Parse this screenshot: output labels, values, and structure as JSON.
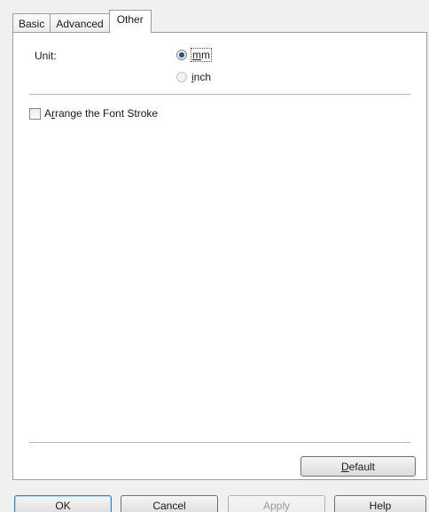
{
  "tabs": [
    {
      "label": "Basic",
      "active": false
    },
    {
      "label": "Advanced",
      "active": false
    },
    {
      "label": "Other",
      "active": true
    }
  ],
  "unit": {
    "label": "Unit:",
    "options": [
      {
        "label_first": "m",
        "label_rest": "m",
        "selected": true
      },
      {
        "label_first": "i",
        "label_rest": "nch",
        "selected": false
      }
    ]
  },
  "arrange_font_stroke": {
    "label_prefix": "A",
    "label_underlined": "r",
    "label_rest": "range the Font Stroke",
    "checked": false
  },
  "buttons": {
    "default_first": "D",
    "default_rest": "efault",
    "ok": "OK",
    "cancel": "Cancel",
    "apply": "Apply",
    "help": "Help"
  }
}
